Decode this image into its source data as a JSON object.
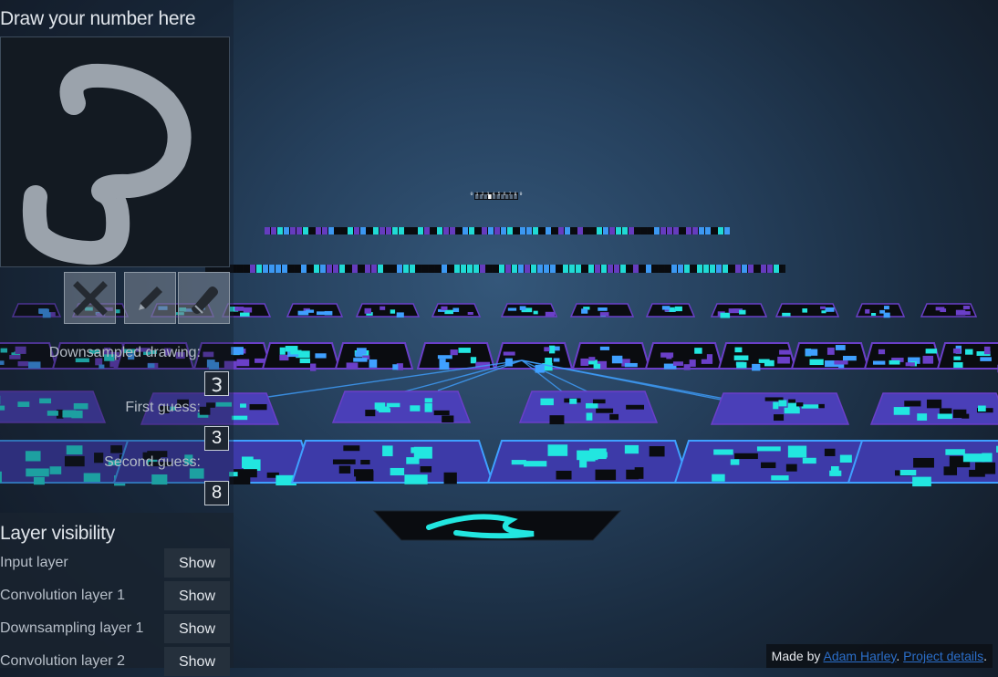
{
  "draw_panel": {
    "title": "Draw your number here",
    "tools": [
      {
        "icon": "clear-x-icon"
      },
      {
        "icon": "pencil-icon"
      },
      {
        "icon": "eraser-icon"
      }
    ]
  },
  "results": {
    "downsampled_label": "Downsampled drawing:",
    "first_guess_label": "First guess:",
    "first_guess_value": "3",
    "second_guess_label": "Second guess:",
    "second_guess_value": "8"
  },
  "layer_visibility": {
    "title": "Layer visibility",
    "layers": [
      {
        "name": "Input layer",
        "button": "Show"
      },
      {
        "name": "Convolution layer 1",
        "button": "Show"
      },
      {
        "name": "Downsampling layer 1",
        "button": "Show"
      },
      {
        "name": "Convolution layer 2",
        "button": "Show"
      }
    ]
  },
  "credits": {
    "prefix": "Made by ",
    "author": "Adam Harley",
    "sep": ". ",
    "project": "Project details",
    "suffix": "."
  },
  "scene": {
    "output_labels": "0 1 2 3 4 5 6 7 8 9",
    "colors": {
      "cyan": "#22e6e0",
      "blue": "#3fa0ff",
      "purple": "#6a3fc8",
      "dark": "#0a0c10"
    }
  }
}
